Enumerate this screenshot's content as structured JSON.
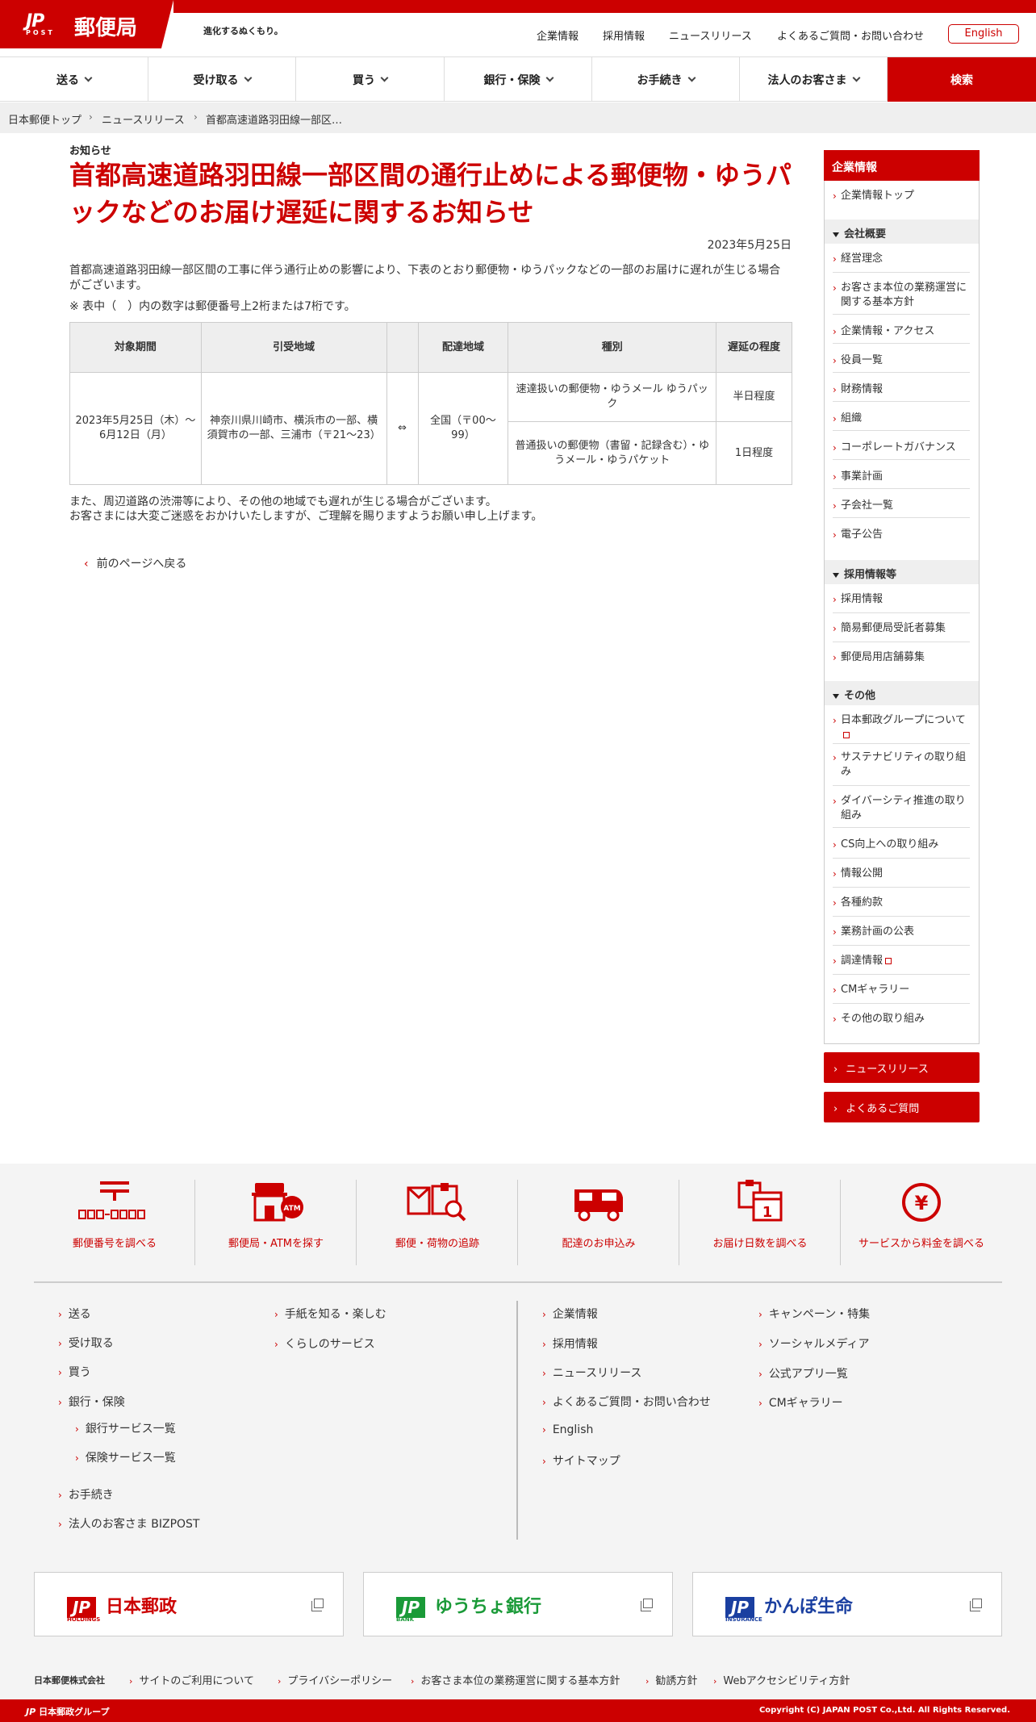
{
  "header": {
    "logo_mark": "JP",
    "logo_post": "POST",
    "logo_text": "郵便局",
    "tagline": "進化するぬくもり。",
    "util_links": [
      "企業情報",
      "採用情報",
      "ニュースリリース",
      "よくあるご質問・お問い合わせ"
    ],
    "english": "English"
  },
  "nav": {
    "items": [
      "送る",
      "受け取る",
      "買う",
      "銀行・保険",
      "お手続き",
      "法人のお客さま"
    ],
    "search": "検索"
  },
  "breadcrumb": [
    "日本郵便トップ",
    "ニュースリリース",
    "首都高速道路羽田線一部区…"
  ],
  "article": {
    "category": "お知らせ",
    "title": "首都高速道路羽田線一部区間の通行止めによる郵便物・ゆうパックなどのお届け遅延に関するお知らせ",
    "date": "2023年5月25日",
    "body1": "首都高速道路羽田線一部区間の工事に伴う通行止めの影響により、下表のとおり郵便物・ゆうパックなどの一部のお届けに遅れが生じる場合がございます。",
    "body2": "※ 表中（　）内の数字は郵便番号上2桁または7桁です。",
    "table": {
      "headers": [
        "対象期間",
        "引受地域",
        "",
        "配達地域",
        "種別",
        "遅延の程度"
      ],
      "period": "2023年5月25日（木）～6月12日（月）",
      "origin": "神奈川県川崎市、横浜市の一部、横須賀市の一部、三浦市（〒21～23）",
      "arrow": "⇔",
      "dest": "全国（〒00～99）",
      "type1": "速達扱いの郵便物・ゆうメール ゆうパック",
      "delay1": "半日程度",
      "type2": "普通扱いの郵便物（書留・記録含む）・ゆうメール・ゆうパケット",
      "delay2": "1日程度"
    },
    "after1": "また、周辺道路の渋滞等により、その他の地域でも遅れが生じる場合がございます。",
    "after2": "お客さまには大変ご迷惑をおかけいたしますが、ご理解を賜りますようお願い申し上げます。",
    "back": "前のページへ戻る"
  },
  "sidebar": {
    "head": "企業情報",
    "top": "企業情報トップ",
    "sections": [
      {
        "title": "会社概要",
        "items": [
          "経営理念",
          "お客さま本位の業務運営に関する基本方針",
          "企業情報・アクセス",
          "役員一覧",
          "財務情報",
          "組織",
          "コーポレートガバナンス",
          "事業計画",
          "子会社一覧",
          "電子公告"
        ]
      },
      {
        "title": "採用情報等",
        "items": [
          "採用情報",
          "簡易郵便局受託者募集",
          "郵便局用店舗募集"
        ]
      },
      {
        "title": "その他",
        "items": [
          "日本郵政グループについて",
          "サステナビリティの取り組み",
          "ダイバーシティ推進の取り組み",
          "CS向上への取り組み",
          "情報公開",
          "各種約款",
          "業務計画の公表",
          "調達情報",
          "CMギャラリー",
          "その他の取り組み"
        ]
      }
    ],
    "buttons": [
      "ニュースリリース",
      "よくあるご質問"
    ]
  },
  "footer": {
    "icons": [
      {
        "label": "郵便番号を調べる",
        "icon": "postal-code-icon",
        "code": "〒 □□□-□□□□"
      },
      {
        "label": "郵便局・ATMを探す",
        "icon": "post-office-atm-icon"
      },
      {
        "label": "郵便・荷物の追跡",
        "icon": "tracking-icon"
      },
      {
        "label": "配達のお申込み",
        "icon": "delivery-truck-icon"
      },
      {
        "label": "お届け日数を調べる",
        "icon": "calendar-icon"
      },
      {
        "label": "サービスから料金を調べる",
        "icon": "yen-icon"
      }
    ],
    "col1": [
      "送る",
      "受け取る",
      "買う",
      "銀行・保険"
    ],
    "col1_sub": [
      "銀行サービス一覧",
      "保険サービス一覧"
    ],
    "col1_more": [
      "お手続き",
      "法人のお客さま BIZPOST"
    ],
    "col2": [
      "手紙を知る・楽しむ",
      "くらしのサービス"
    ],
    "col3": [
      "企業情報",
      "採用情報",
      "ニュースリリース",
      "よくあるご質問・お問い合わせ",
      "English",
      "サイトマップ"
    ],
    "col4": [
      "キャンペーン・特集",
      "ソーシャルメディア",
      "公式アプリ一覧",
      "CMギャラリー"
    ],
    "brands": [
      {
        "name": "日本郵政",
        "sub": "HOLDINGS",
        "color": "#cc0000"
      },
      {
        "name": "ゆうちょ銀行",
        "sub": "BANK",
        "color": "#1a9a38"
      },
      {
        "name": "かんぽ生命",
        "sub": "INSURANCE",
        "color": "#1a3fa0"
      }
    ],
    "company": "日本郵便株式会社",
    "legal": [
      "サイトのご利用について",
      "プライバシーポリシー",
      "お客さま本位の業務運営に関する基本方針",
      "勧誘方針",
      "Webアクセシビリティ方針"
    ],
    "group": "日本郵政グループ",
    "copyright": "Copyright (C) JAPAN POST Co.,Ltd.  All Rights Reserved."
  },
  "colors": {
    "brand_red": "#cc0000",
    "bank_green": "#1a9a38",
    "insurance_blue": "#1a3fa0"
  }
}
